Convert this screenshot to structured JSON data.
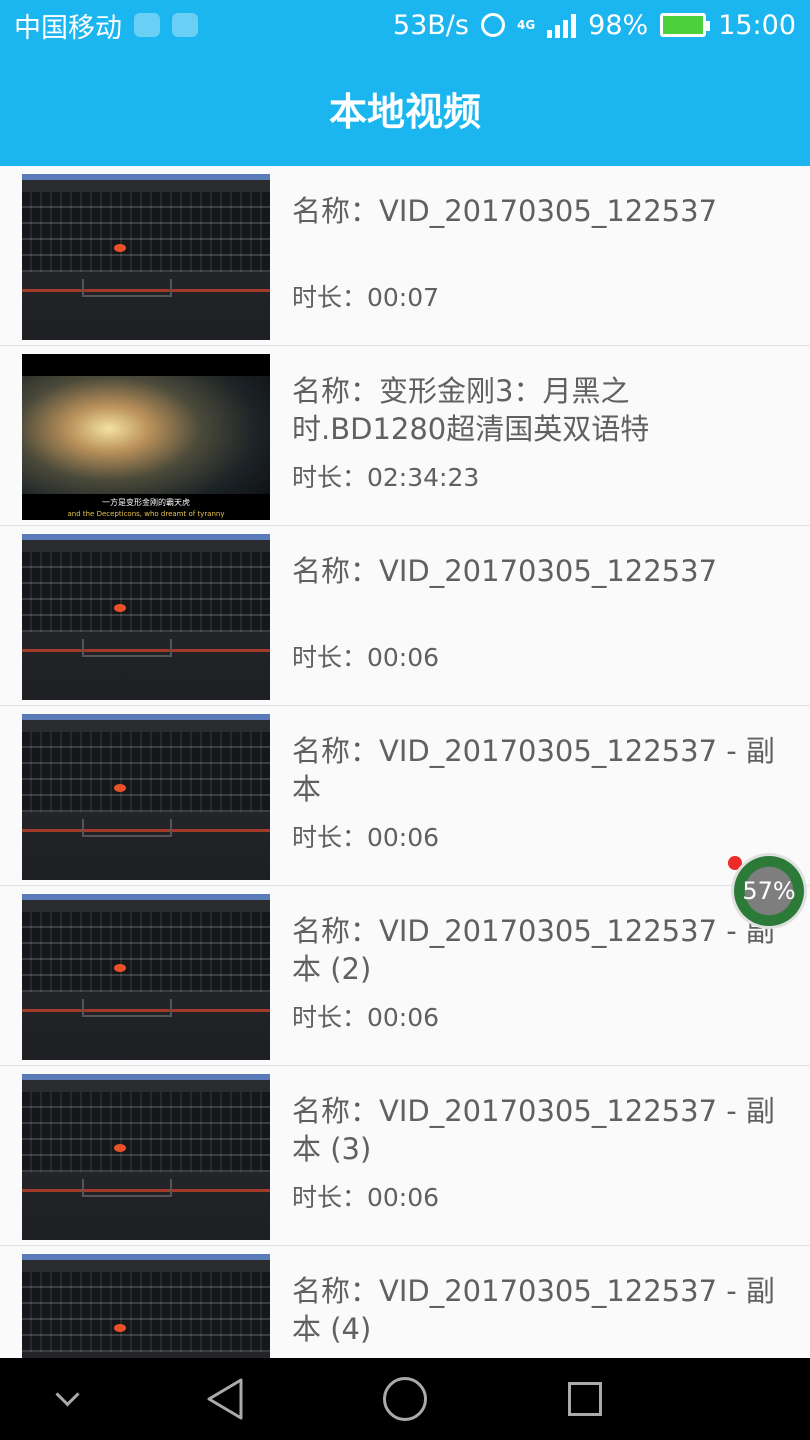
{
  "status_bar": {
    "carrier": "中国移动",
    "net_speed": "53B/s",
    "network": "4G",
    "battery": "98%",
    "time": "15:00"
  },
  "title": "本地视频",
  "videos": [
    {
      "name": "名称：VID_20170305_122537",
      "duration": "时长：00:07",
      "thumb": "laptop"
    },
    {
      "name": "名称：变形金刚3：月黑之时.BD1280超清国英双语特",
      "duration": "时长：02:34:23",
      "thumb": "movie",
      "subtitle_cn": "一方是变形金刚的霸天虎",
      "subtitle_en": "and the Decepticons, who dreamt of tyranny"
    },
    {
      "name": "名称：VID_20170305_122537",
      "duration": "时长：00:06",
      "thumb": "laptop"
    },
    {
      "name": "名称：VID_20170305_122537 - 副本",
      "duration": "时长：00:06",
      "thumb": "laptop"
    },
    {
      "name": "名称：VID_20170305_122537 - 副本 (2)",
      "duration": "时长：00:06",
      "thumb": "laptop"
    },
    {
      "name": "名称：VID_20170305_122537 - 副本 (3)",
      "duration": "时长：00:06",
      "thumb": "laptop"
    },
    {
      "name": "名称：VID_20170305_122537 - 副本 (4)",
      "duration": "",
      "thumb": "laptop"
    }
  ],
  "float_badge": "57%",
  "colors": {
    "accent": "#1bb6ef",
    "badge_green": "#2b7a37",
    "badge_dot": "#ee2a2a"
  },
  "nav": {
    "buttons": [
      "chevron-down-icon",
      "back-icon",
      "home-icon",
      "recents-icon"
    ]
  }
}
